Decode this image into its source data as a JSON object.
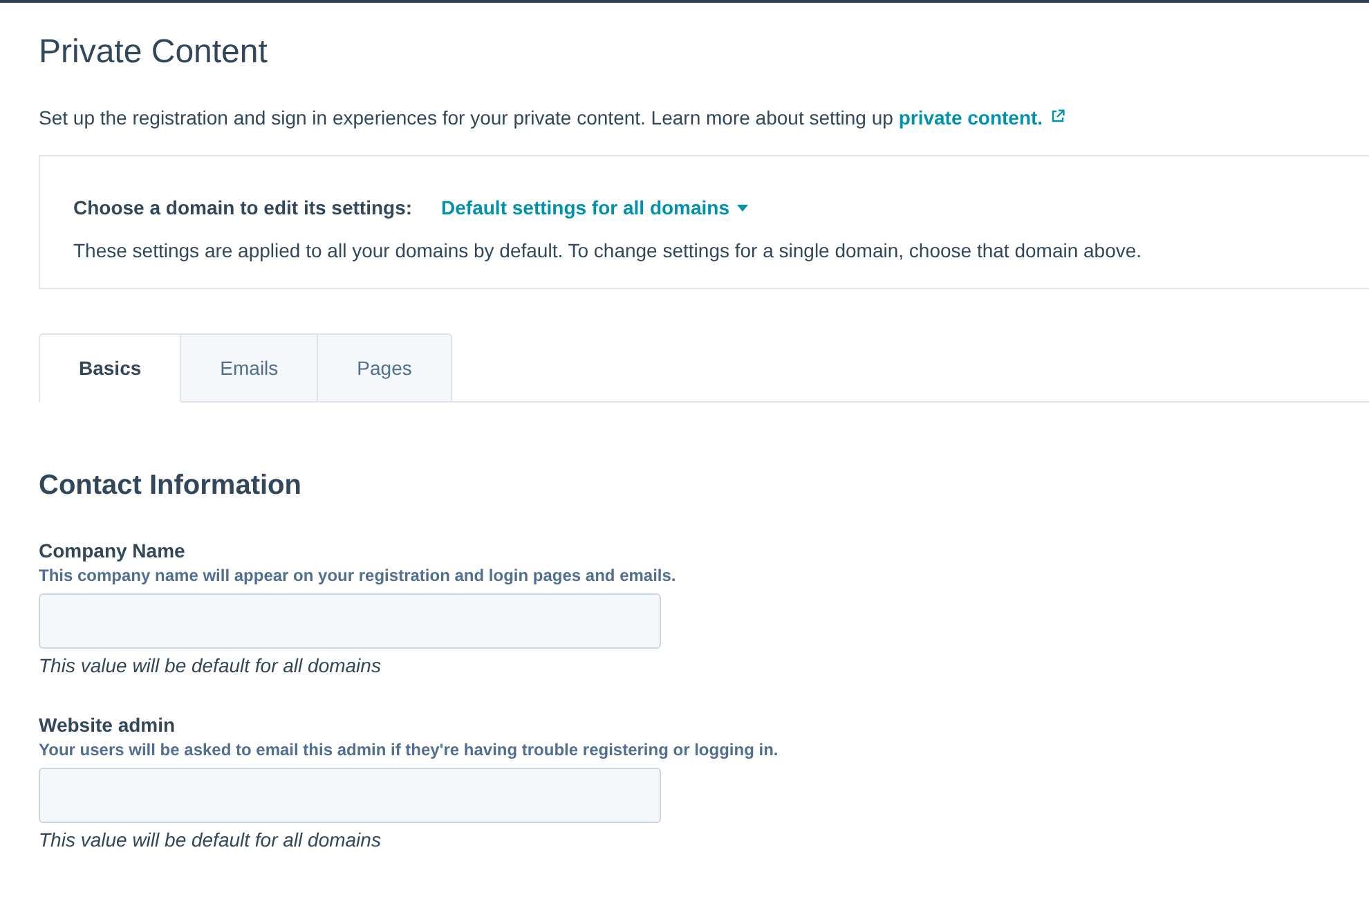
{
  "page": {
    "title": "Private Content",
    "description": {
      "text": "Set up the registration and sign in experiences for your private content. Learn more about setting up ",
      "link": "private content."
    }
  },
  "domain_picker": {
    "label": "Choose a domain to edit its settings:",
    "value": "Default settings for all domains",
    "note": "These settings are applied to all your domains by default. To change settings for a single domain, choose that domain above."
  },
  "tabs": [
    {
      "label": "Basics",
      "selected": true
    },
    {
      "label": "Emails",
      "selected": false
    },
    {
      "label": "Pages",
      "selected": false
    }
  ],
  "section": {
    "heading": "Contact Information",
    "fields": [
      {
        "label": "Company Name",
        "help": "This company name will appear on your registration and login pages and emails.",
        "hint": "This value will be default for all domains"
      },
      {
        "label": "Website admin",
        "help": "Your users will be asked to email this admin if they're having trouble registering or logging in.",
        "hint": "This value will be default for all domains"
      }
    ]
  }
}
